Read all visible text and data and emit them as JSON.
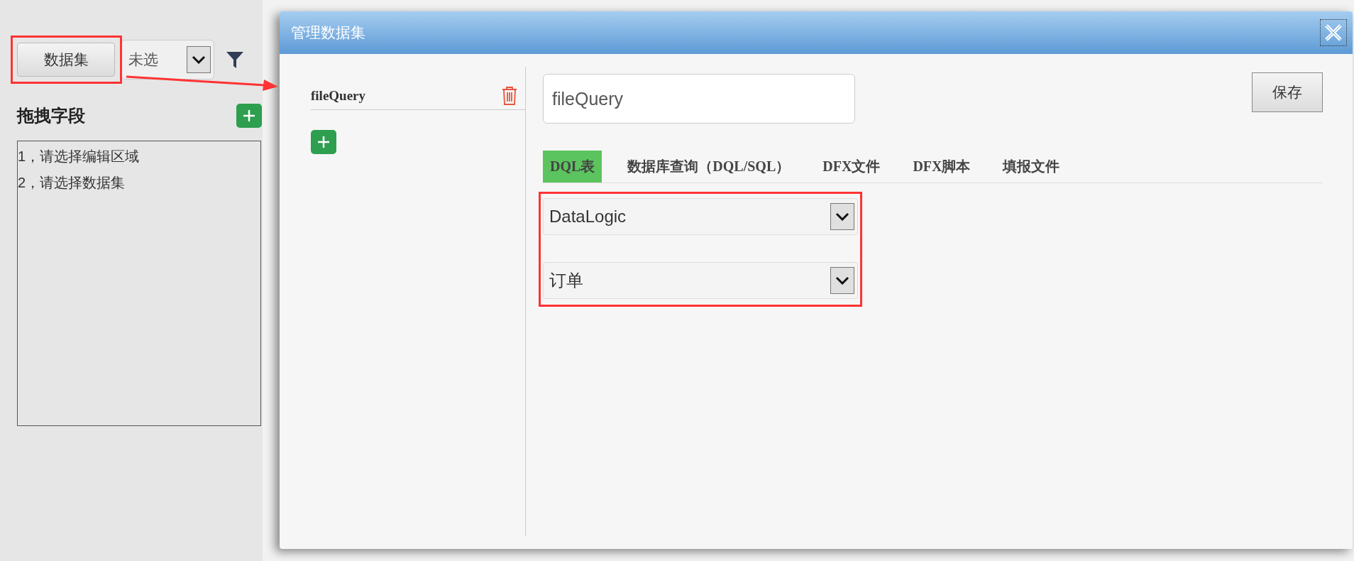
{
  "sidebar": {
    "dataset_button": "数据集",
    "dataset_select": {
      "value": "未选"
    },
    "heading": "拖拽字段",
    "hints": [
      "1，请选择编辑区域",
      "2，请选择数据集"
    ]
  },
  "dialog": {
    "title": "管理数据集",
    "datasets": [
      {
        "name": "fileQuery"
      }
    ],
    "name_field": {
      "value": "fileQuery"
    },
    "save_button": "保存",
    "tabs": [
      {
        "label": "DQL表",
        "selected": true
      },
      {
        "label": "数据库查询（DQL/SQL）",
        "selected": false
      },
      {
        "label": "DFX文件",
        "selected": false
      },
      {
        "label": "DFX脚本",
        "selected": false
      },
      {
        "label": "填报文件",
        "selected": false
      }
    ],
    "selects": [
      {
        "value": "DataLogic"
      },
      {
        "value": "订单"
      }
    ]
  }
}
